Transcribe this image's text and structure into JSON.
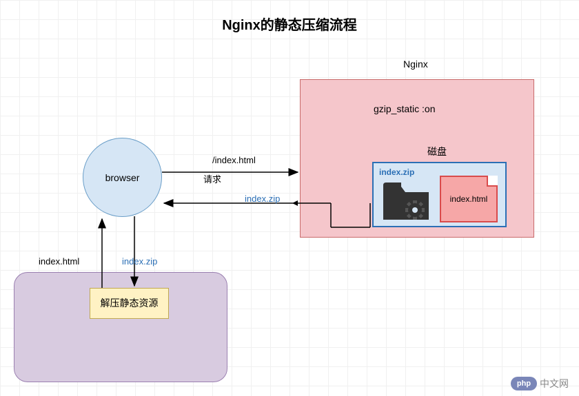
{
  "title": "Nginx的静态压缩流程",
  "nginx": {
    "name": "Nginx",
    "config": "gzip_static :on",
    "disk": {
      "label": "磁盘",
      "zip_name": "index.zip",
      "file_name": "index.html"
    }
  },
  "browser": "browser",
  "arrows": {
    "request_path": "/index.html",
    "request_label": "请求",
    "response_zip": "index.zip",
    "down_zip": "index.zip",
    "up_html": "index.html"
  },
  "decompress": "解压静态资源",
  "watermark": {
    "logo": "php",
    "text": "中文网"
  }
}
